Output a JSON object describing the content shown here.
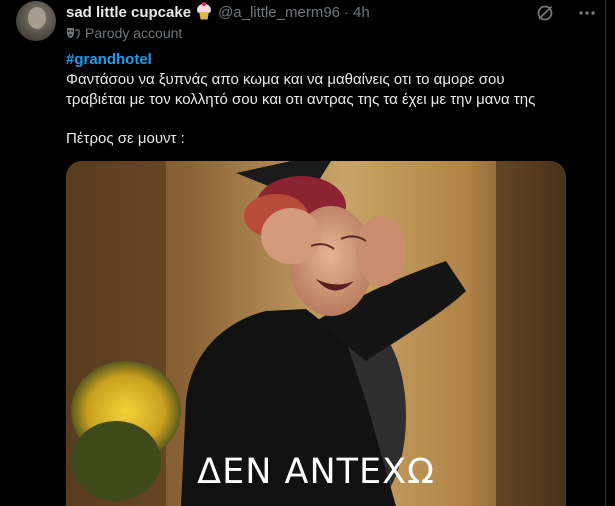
{
  "tweet": {
    "display_name": "sad little cupcake",
    "name_emoji_icon": "cupcake-icon",
    "handle": "@a_little_merm96",
    "separator": "·",
    "time": "4h",
    "label_icon": "theater-masks-icon",
    "label": "Parody account",
    "hashtag": "#grandhotel",
    "text_lines": [
      "Φαντάσου να ξυπνάς απο κωμα και να μαθαίνεις οτι το αμορε σου",
      "τραβιέται με τον κολλητό σου και οτι αντρας της τα έχει με την μανα της"
    ],
    "text_line_3": "Πέτρος σε μουντ :",
    "media_caption": "ΔΕΝ ΑΝΤΕΧΩ",
    "actions_icons": [
      "grok-icon",
      "more-icon"
    ]
  },
  "colors": {
    "background": "#000000",
    "primary_text": "#e7e9ea",
    "secondary_text": "#71767b",
    "link": "#1d9bf0"
  }
}
